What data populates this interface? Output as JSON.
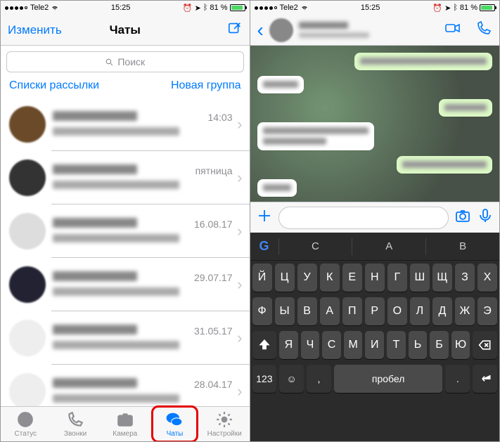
{
  "status": {
    "carrier": "Tele2",
    "time": "15:25",
    "battery_pct": "81 %",
    "signal_dots": 4
  },
  "chats_screen": {
    "edit": "Изменить",
    "title": "Чаты",
    "search_placeholder": "Поиск",
    "broadcast_lists": "Списки рассылки",
    "new_group": "Новая группа",
    "rows": [
      {
        "time": "14:03"
      },
      {
        "time": "пятница"
      },
      {
        "time": "16.08.17"
      },
      {
        "time": "29.07.17"
      },
      {
        "time": "31.05.17"
      },
      {
        "time": "28.04.17"
      }
    ],
    "tabs": {
      "status": "Статус",
      "calls": "Звонки",
      "camera": "Камера",
      "chats": "Чаты",
      "settings": "Настройки"
    }
  },
  "keyboard": {
    "suggestions": [
      "С",
      "А",
      "В"
    ],
    "row1": [
      "Й",
      "Ц",
      "У",
      "К",
      "Е",
      "Н",
      "Г",
      "Ш",
      "Щ",
      "З",
      "Х"
    ],
    "row2": [
      "Ф",
      "Ы",
      "В",
      "А",
      "П",
      "Р",
      "О",
      "Л",
      "Д",
      "Ж",
      "Э"
    ],
    "row3": [
      "Я",
      "Ч",
      "С",
      "М",
      "И",
      "Т",
      "Ь",
      "Б",
      "Ю"
    ],
    "numbers_key": "123",
    "space": "пробел"
  }
}
